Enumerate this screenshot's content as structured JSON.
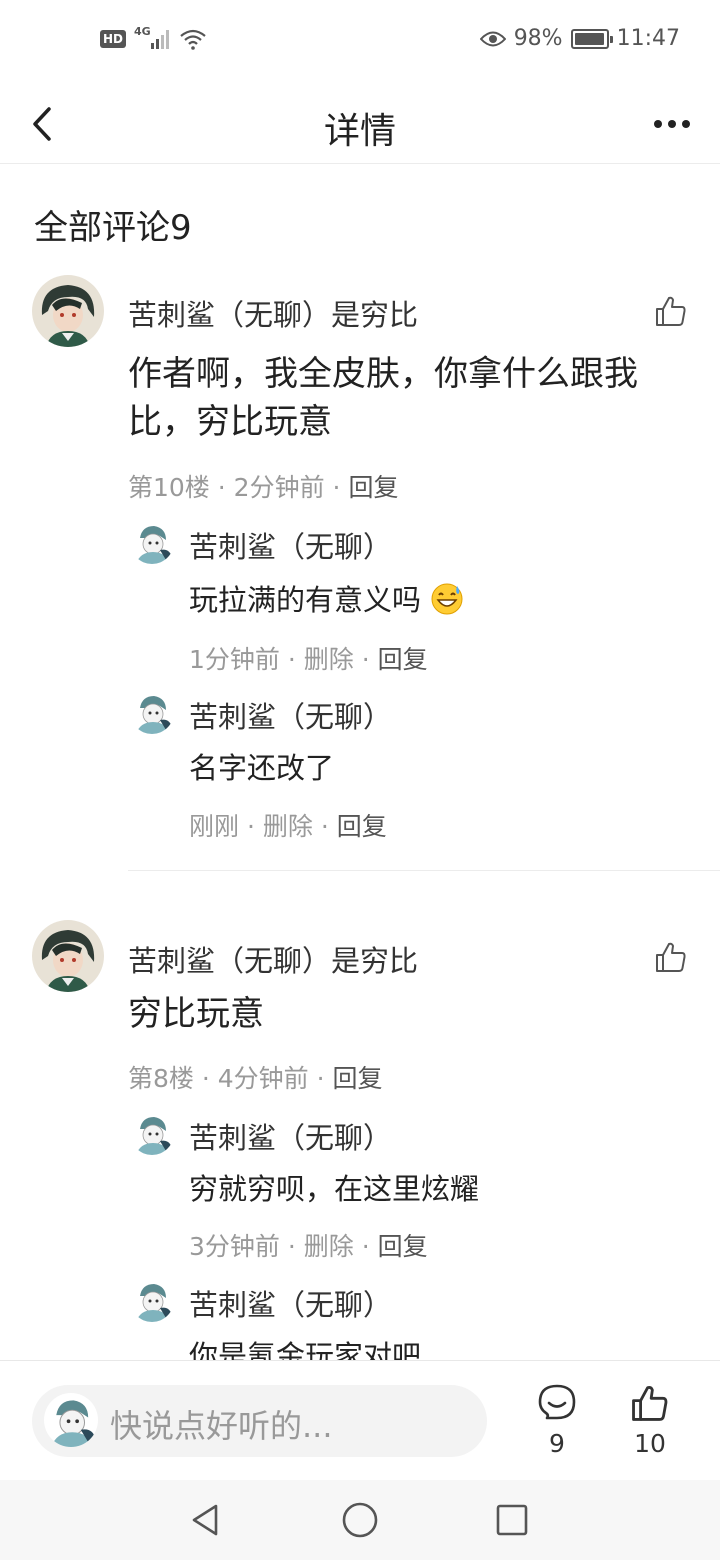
{
  "status_bar": {
    "hd": "HD",
    "network": "4G",
    "battery_percent": "98%",
    "battery_level": 0.98,
    "time": "11:47",
    "icons": [
      "signal-icon",
      "wifi-icon",
      "eye-icon",
      "battery-icon"
    ]
  },
  "header": {
    "title": "详情",
    "back_icon": "chevron-left-icon",
    "more_icon": "more-dots-icon"
  },
  "section_title": "全部评论9",
  "comments": [
    {
      "author": "苦刺鲨（无聊）是穷比",
      "text": "作者啊，我全皮肤，你拿什么跟我比，穷比玩意",
      "floor": "第10楼",
      "time": "2分钟前",
      "reply_label": "回复",
      "replies": [
        {
          "author": "苦刺鲨（无聊）",
          "text": "玩拉满的有意义吗",
          "emoji": "sweat-smile-emoji",
          "time": "1分钟前",
          "delete_label": "删除",
          "reply_label": "回复"
        },
        {
          "author": "苦刺鲨（无聊）",
          "text": "名字还改了",
          "time": "刚刚",
          "delete_label": "删除",
          "reply_label": "回复"
        }
      ]
    },
    {
      "author": "苦刺鲨（无聊）是穷比",
      "text": "穷比玩意",
      "floor": "第8楼",
      "time": "4分钟前",
      "reply_label": "回复",
      "replies": [
        {
          "author": "苦刺鲨（无聊）",
          "text": "穷就穷呗，在这里炫耀",
          "time": "3分钟前",
          "delete_label": "删除",
          "reply_label": "回复"
        },
        {
          "author": "苦刺鲨（无聊）",
          "text": "你是氪金玩家对吧"
        }
      ]
    }
  ],
  "bottom_bar": {
    "input_placeholder": "快说点好听的...",
    "comment_count": "9",
    "like_count": "10"
  },
  "colors": {
    "text_primary": "#222222",
    "text_secondary": "#999999",
    "divider": "#ececec",
    "input_bg": "#f3f3f3"
  }
}
